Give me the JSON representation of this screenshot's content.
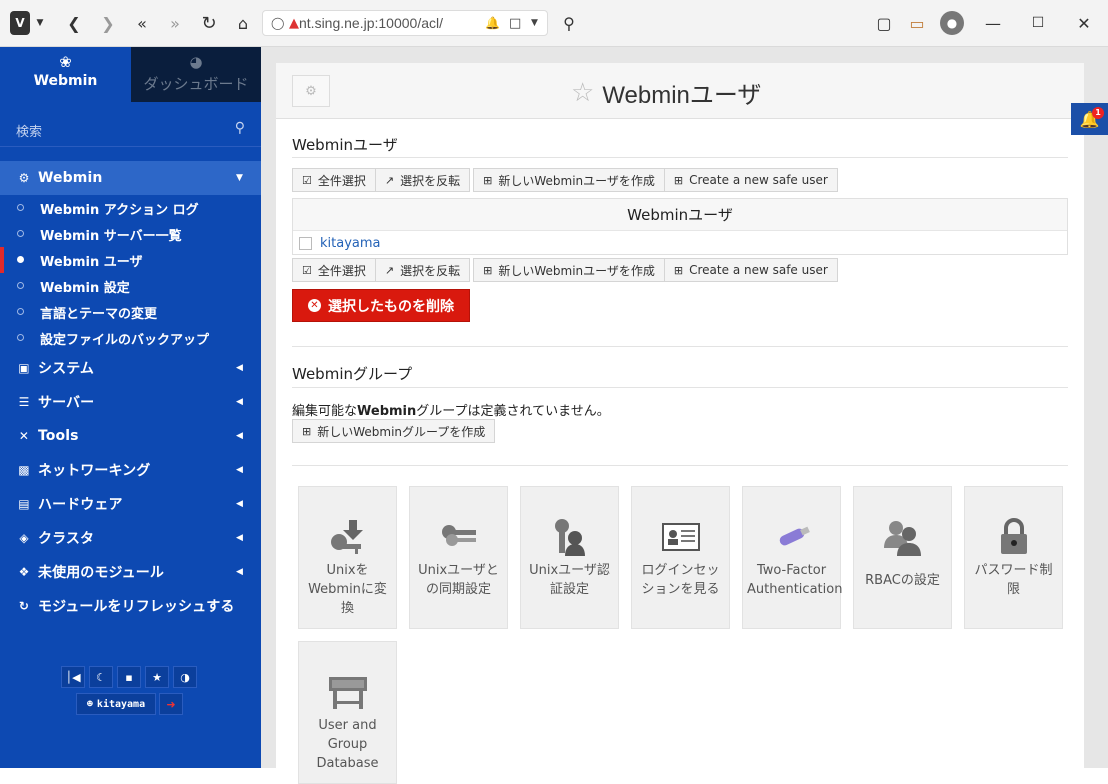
{
  "browser": {
    "url": "nt.sing.ne.jp:10000/acl/"
  },
  "sidebar": {
    "tab_webmin": "Webmin",
    "tab_dashboard": "ダッシュボード",
    "search_placeholder": "検索",
    "webmin_menu": "Webmin",
    "sub_items": [
      "Webmin アクション ログ",
      "Webmin サーバー一覧",
      "Webmin ユーザ",
      "Webmin 設定",
      "言語とテーマの変更",
      "設定ファイルのバックアップ"
    ],
    "menus": [
      "システム",
      "サーバー",
      "Tools",
      "ネットワーキング",
      "ハードウェア",
      "クラスタ",
      "未使用のモジュール"
    ],
    "refresh": "モジュールをリフレッシュする",
    "user": "kitayama"
  },
  "page": {
    "title": "Webminユーザ",
    "users_section": "Webminユーザ",
    "btn_select_all": "全件選択",
    "btn_invert": "選択を反転",
    "btn_new_user": "新しいWebminユーザを作成",
    "btn_new_safe": "Create a new safe user",
    "table_header": "Webminユーザ",
    "users": [
      "kitayama"
    ],
    "delete_btn": "選択したものを削除",
    "groups_section": "Webminグループ",
    "groups_note_pre": "編集可能な",
    "groups_note_bold": "Webmin",
    "groups_note_post": "グループは定義されていません。",
    "btn_new_group": "新しいWebminグループを作成",
    "tiles": [
      {
        "label": "UnixをWebminに変換",
        "icon": "unix-to-webmin-icon"
      },
      {
        "label": "Unixユーザとの同期設定",
        "icon": "sync-icon"
      },
      {
        "label": "Unixユーザ認証設定",
        "icon": "auth-icon"
      },
      {
        "label": "ログインセッションを見る",
        "icon": "session-icon"
      },
      {
        "label": "Two-Factor Authentication",
        "icon": "usb-key-icon"
      },
      {
        "label": "RBACの設定",
        "icon": "rbac-icon"
      },
      {
        "label": "パスワード制限",
        "icon": "lock-icon"
      },
      {
        "label": "User and Group Database",
        "icon": "mysql-icon"
      }
    ]
  },
  "notifications": {
    "count": "1"
  }
}
